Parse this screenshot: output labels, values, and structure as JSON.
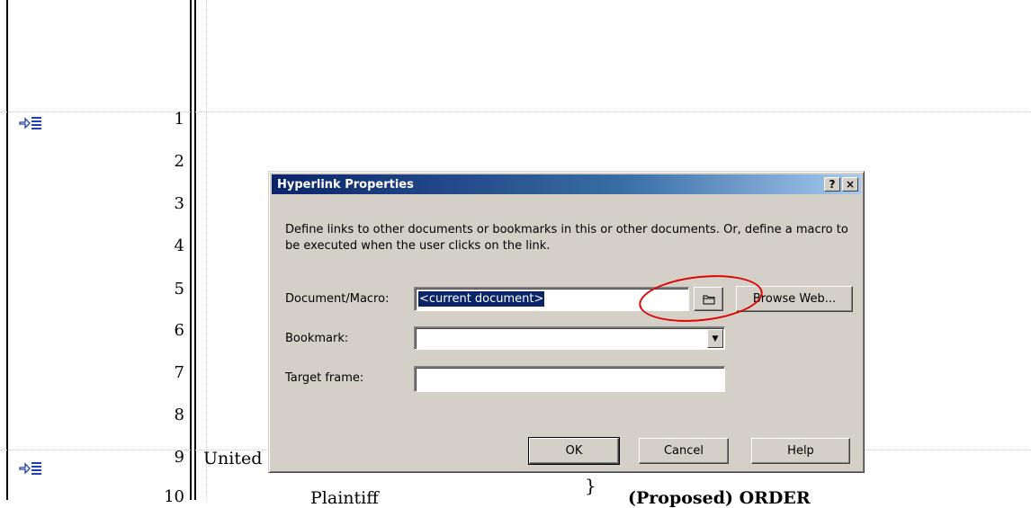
{
  "document": {
    "line_numbers": [
      "1",
      "2",
      "3",
      "4",
      "5",
      "6",
      "7",
      "8",
      "9",
      "10"
    ],
    "text_united": "United",
    "text_plaintiff": "Plaintiff",
    "text_brace": "}",
    "text_proposed_order": "(Proposed) ORDER"
  },
  "dialog": {
    "title": "Hyperlink Properties",
    "help_button": "?",
    "close_button": "×",
    "description": "Define links to other documents or bookmarks in this or other documents. Or, define a macro to be executed when the user clicks on the link.",
    "document_macro_label": "Document/Macro:",
    "document_macro_value": "<current document>",
    "browse_web_label": "Browse Web...",
    "bookmark_label": "Bookmark:",
    "bookmark_value": "",
    "target_frame_label": "Target frame:",
    "target_frame_value": "",
    "ok_label": "OK",
    "cancel_label": "Cancel",
    "help_label": "Help"
  },
  "colors": {
    "title_gradient_start": "#0a246a",
    "title_gradient_end": "#a6caf0",
    "dialog_face": "#d4d0c8",
    "annotation": "#e00000",
    "para_marker": "#1f3fb0"
  }
}
